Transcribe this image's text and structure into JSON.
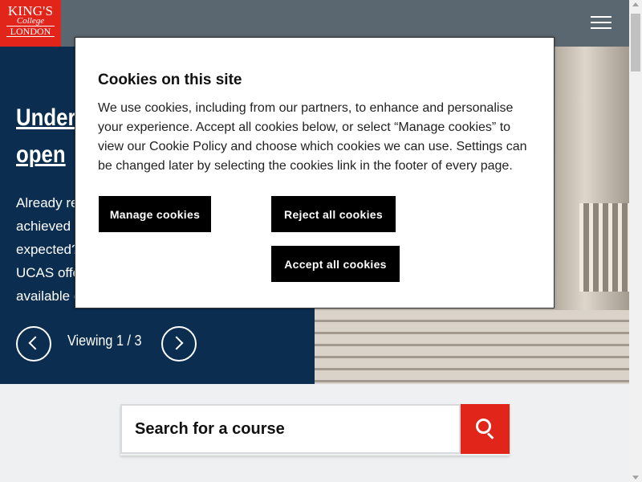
{
  "logo": {
    "line1": "KING'S",
    "line2": "College",
    "line3": "LONDON"
  },
  "header": {
    "menu_icon": "hamburger-menu-icon"
  },
  "hero": {
    "title_line1": "Under",
    "title_line2": "open",
    "text_lines": [
      "Already re",
      "achieved b",
      "expected?",
      "UCAS offe",
      "available o"
    ],
    "viewing": "Viewing 1  / 3",
    "prev_icon": "chevron-left-icon",
    "next_icon": "chevron-right-icon"
  },
  "search": {
    "placeholder": "Search for a course",
    "icon": "search-icon"
  },
  "cookie": {
    "title": "Cookies on this site",
    "body": "We use cookies, including from our partners, to enhance and personalise your experience. Accept all cookies below, or select “Manage cookies” to view our Cookie Policy and choose which cookies we can use. Settings can be changed later by selecting the cookies link in the footer of every page.",
    "manage_label": "Manage cookies",
    "reject_label": "Reject all cookies",
    "accept_label": "Accept all cookies"
  },
  "colors": {
    "brand_red": "#e1251b",
    "navy": "#0a2d50",
    "header_gray": "#5b6770"
  }
}
